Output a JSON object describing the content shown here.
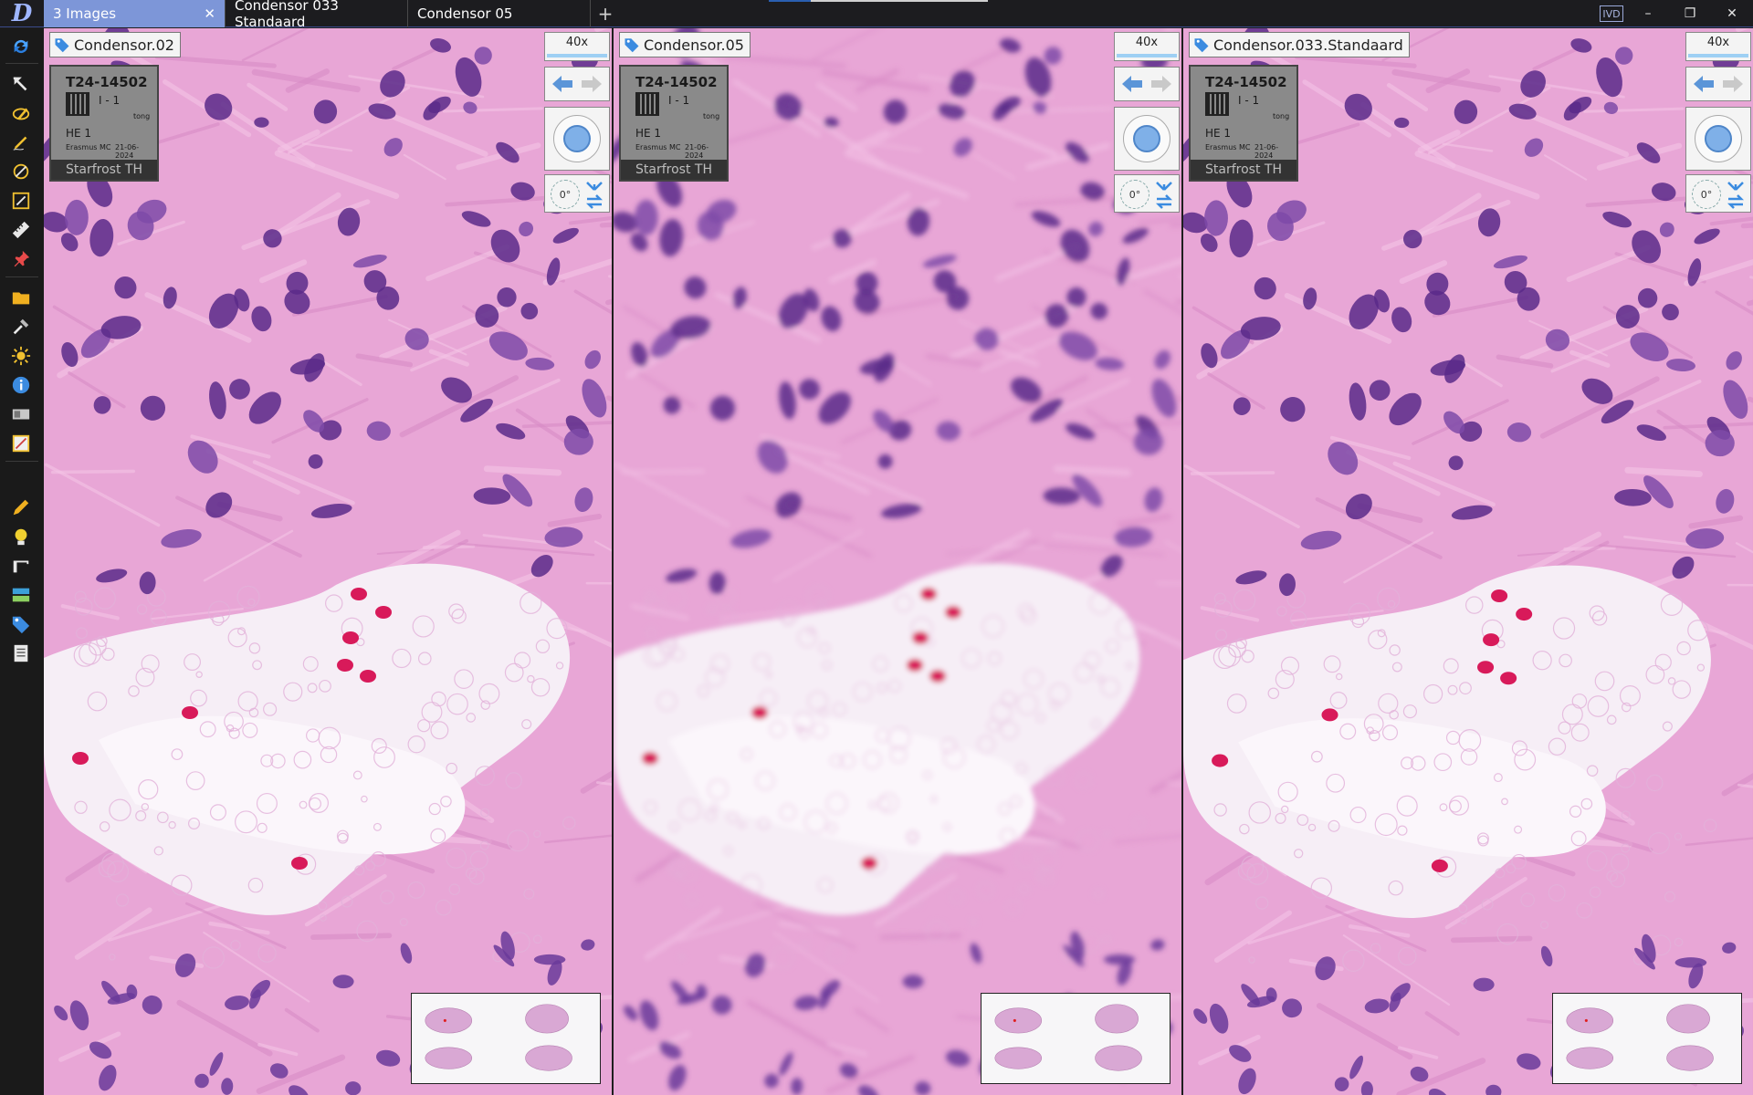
{
  "titlebar": {
    "tabs": [
      {
        "label": "3 Images",
        "active": true
      },
      {
        "label": "Condensor 033 Standaard",
        "active": false
      },
      {
        "label": "Condensor 05",
        "active": false
      }
    ],
    "add_tab_glyph": "+",
    "close_glyph": "✕",
    "ivd_badge": "IVD",
    "window_buttons": {
      "minimize": "–",
      "restore": "❐",
      "close": "✕"
    }
  },
  "toolbar": {
    "tools": [
      "refresh-icon",
      "select-arrow-icon",
      "annotation-pen-icon",
      "freehand-pencil-icon",
      "measure-compass-icon",
      "ruler-edit-icon",
      "ruler-icon",
      "pin-icon",
      "folder-open-icon",
      "settings-tools-icon",
      "brightness-icon",
      "info-icon",
      "slide-label-icon",
      "image-adjust-icon",
      "pencil-icon",
      "bulb-icon",
      "clamp-icon",
      "layout-icon",
      "tag-icon",
      "report-icon"
    ]
  },
  "viewports": [
    {
      "slide_name": "Condensor.02",
      "selected": false,
      "zoom": "40x",
      "rotation": "0°",
      "label": {
        "case": "T24-14502",
        "block": "I - 1",
        "tissue": "tong",
        "stain": "HE 1",
        "site": "Erasmus MC",
        "date": "21-06-2024",
        "footer": "Starfrost TH"
      }
    },
    {
      "slide_name": "Condensor.05",
      "selected": false,
      "zoom": "40x",
      "rotation": "0°",
      "label": {
        "case": "T24-14502",
        "block": "I - 1",
        "tissue": "tong",
        "stain": "HE 1",
        "site": "Erasmus MC",
        "date": "21-06-2024",
        "footer": "Starfrost TH"
      }
    },
    {
      "slide_name": "Condensor.033.Standaard",
      "selected": true,
      "zoom": "40x",
      "rotation": "0°",
      "label": {
        "case": "T24-14502",
        "block": "I - 1",
        "tissue": "tong",
        "stain": "HE 1",
        "site": "Erasmus MC",
        "date": "21-06-2024",
        "footer": "Starfrost TH"
      }
    }
  ],
  "colors": {
    "active_tab": "#7d96d8",
    "selected_viewport_border": "#d02030",
    "stroma_pink": "#e8a6d6",
    "nucleus_purple": "#5a2a8a",
    "rbc_red": "#d81a5a"
  }
}
